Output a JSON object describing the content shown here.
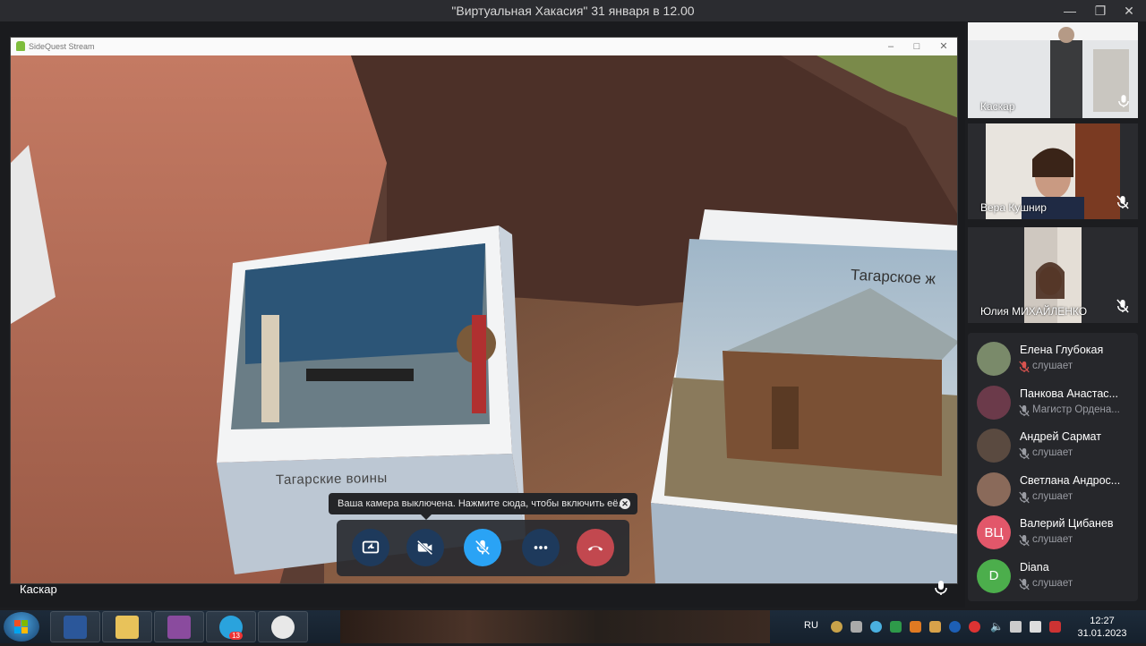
{
  "window": {
    "title": "\"Виртуальная Хакасия\" 31 января в 12.00",
    "minimize_icon": "minimize-icon",
    "restore_icon": "restore-icon",
    "close_icon": "close-icon"
  },
  "stream": {
    "app_title": "SideQuest Stream",
    "scene_labels": {
      "left_cube": "Тагарские воины",
      "right_cube": "Тагарское ж"
    },
    "presenter_name": "Каскар",
    "toast": "Ваша камера выключена. Нажмите сюда, чтобы включить её.",
    "controls": [
      {
        "name": "share-screen",
        "icon": "share-screen-icon"
      },
      {
        "name": "camera-off",
        "icon": "camera-off-icon"
      },
      {
        "name": "mic-off",
        "icon": "mic-off-icon"
      },
      {
        "name": "more",
        "icon": "more-icon"
      },
      {
        "name": "hang-up",
        "icon": "hang-up-icon"
      }
    ]
  },
  "video_tiles": [
    {
      "name": "Каскар",
      "mic": "mic-icon"
    },
    {
      "name": "Вера Кушнир",
      "mic": "mic-off-icon"
    },
    {
      "name": "Юлия МИХАЙЛЕНКО",
      "mic": "mic-off-icon"
    }
  ],
  "participants": [
    {
      "name": "Елена Глубокая",
      "status": "слушает",
      "status_color": "#d9534f",
      "avatar": "photo",
      "avatar_color": "#7a8a6a"
    },
    {
      "name": "Панкова Анастас...",
      "status": "Магистр Ордена...",
      "status_color": "#9a9ca3",
      "avatar": "photo",
      "avatar_color": "#6b3a4a"
    },
    {
      "name": "Андрей Сармат",
      "status": "слушает",
      "status_color": "#9a9ca3",
      "avatar": "photo",
      "avatar_color": "#5a4a40"
    },
    {
      "name": "Светлана Андрос...",
      "status": "слушает",
      "status_color": "#9a9ca3",
      "avatar": "photo",
      "avatar_color": "#8a6a5a"
    },
    {
      "name": "Валерий Цибанев",
      "status": "слушает",
      "status_color": "#9a9ca3",
      "avatar": "ВЦ",
      "avatar_color": "#e2576a"
    },
    {
      "name": "Diana",
      "status": "слушает",
      "status_color": "#9a9ca3",
      "avatar": "D",
      "avatar_color": "#4cae4c"
    }
  ],
  "taskbar": {
    "apps": [
      {
        "name": "word",
        "icon": "word-icon",
        "color": "#2b579a"
      },
      {
        "name": "file-explorer",
        "icon": "folder-icon",
        "color": "#e8c25a"
      },
      {
        "name": "winrar",
        "icon": "archive-icon",
        "color": "#8a4b9e"
      },
      {
        "name": "telegram",
        "icon": "telegram-icon",
        "color": "#2aa3dd",
        "badge": "13"
      },
      {
        "name": "chrome",
        "icon": "chrome-icon",
        "color": "#e8e8e8"
      }
    ],
    "language": "RU",
    "time": "12:27",
    "date": "31.01.2023"
  }
}
